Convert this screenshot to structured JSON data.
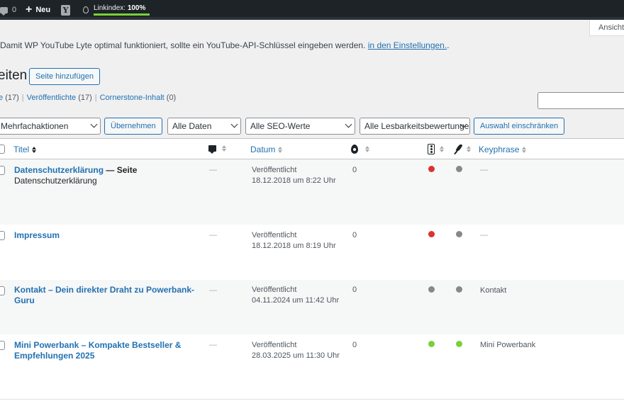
{
  "adminbar": {
    "comments_count": "0",
    "new_label": "Neu",
    "yoast_letter": "Y",
    "linkindex_label": "Linkindex:",
    "linkindex_value": "100%"
  },
  "screen_options": {
    "label": "Ansicht"
  },
  "notice": {
    "text": "Damit WP YouTube Lyte optimal funktioniert, sollte ein YouTube-API-Schlüssel eingeben werden.",
    "link": "in den Einstellungen.",
    "tail": "."
  },
  "page": {
    "title": "eiten",
    "add_button": "Seite hinzufügen"
  },
  "views": [
    {
      "label": "e",
      "count": "(17)"
    },
    {
      "label": "Veröffentlichte",
      "count": "(17)"
    },
    {
      "label": "Cornerstone-Inhalt",
      "count": "(0)"
    }
  ],
  "filters": {
    "bulk": "Mehrfachaktionen",
    "apply": "Übernehmen",
    "dates": "Alle Daten",
    "seo": "Alle SEO-Werte",
    "readability": "Alle Lesbarkeitsbewertungen",
    "filter_button": "Auswahl einschränken"
  },
  "columns": {
    "title": "Titel",
    "date": "Datum",
    "keyphrase": "Keyphrase"
  },
  "colors": {
    "red": "#dc3232",
    "gray": "#888888",
    "green": "#7ad03a"
  },
  "rows": [
    {
      "title": "Datenschutzerklärung",
      "suffix": " — Seite",
      "subline": "Datenschutzerklärung",
      "author": "—",
      "status": "Veröffentlicht",
      "date": "18.12.2018 um 8:22 Uhr",
      "links": "0",
      "seo": "red",
      "readability": "gray",
      "keyphrase": "—"
    },
    {
      "title": "Impressum",
      "suffix": "",
      "subline": "",
      "author": "—",
      "status": "Veröffentlicht",
      "date": "18.12.2018 um 8:19 Uhr",
      "links": "0",
      "seo": "red",
      "readability": "gray",
      "keyphrase": "—"
    },
    {
      "title": "Kontakt – Dein direkter Draht zu Powerbank-Guru",
      "suffix": "",
      "subline": "",
      "author": "—",
      "status": "Veröffentlicht",
      "date": "04.11.2024 um 11:42 Uhr",
      "links": "0",
      "seo": "gray",
      "readability": "gray",
      "keyphrase": "Kontakt"
    },
    {
      "title": "Mini Powerbank – Kompakte Bestseller &",
      "suffix": "",
      "subline": "Empfehlungen 2025",
      "author": "—",
      "status": "Veröffentlicht",
      "date": "28.03.2025 um 11:30 Uhr",
      "links": "0",
      "seo": "green",
      "readability": "green",
      "keyphrase": "Mini Powerbank"
    }
  ]
}
